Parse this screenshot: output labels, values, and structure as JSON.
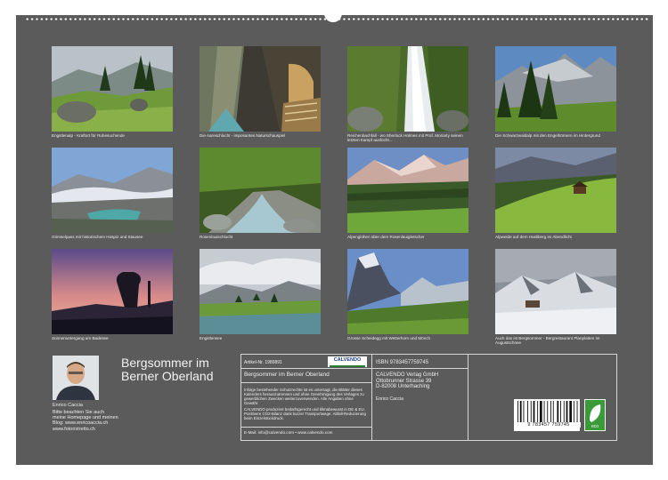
{
  "photos": [
    {
      "caption": "Engstlenalp - Kraftort für Ruhesuchende"
    },
    {
      "caption": "Die Aareschlucht - imposantes Naturschauspiel"
    },
    {
      "caption": "Reichenbachfall - wo Sherlock Holmes mit Prof. Moriarty seinen letzten Kampf ausfocht..."
    },
    {
      "caption": "Die Schwarzwaldalp mit den Engelhörnern im Hintergrund"
    },
    {
      "caption": "Grimselpass mit historischem Hospiz und Stausee"
    },
    {
      "caption": "Rosenlauischlucht"
    },
    {
      "caption": "Alpenglühen über dem Rosenlauigletscher"
    },
    {
      "caption": "Alpweide auf dem Hasliberg im Abendlicht"
    },
    {
      "caption": "Sonnenuntergang am Badesee"
    },
    {
      "caption": "Engstlensee"
    },
    {
      "caption": "Grosse Scheidegg mit Wetterhorn und Mönch"
    },
    {
      "caption": "Auch das ist Bergsommer - Bergrestaurant Planplatten im Augustschnee"
    }
  ],
  "title_line1": "Bergsommer im",
  "title_line2": "Berner Oberland",
  "author": {
    "name": "Enrico Caccia",
    "note_lines": [
      "Bitte beachten Sie auch",
      "meine Homepage und meinen",
      "Blog: www.enricoaccia.ch",
      "www.fotoristretto.ch"
    ]
  },
  "info": {
    "article_no": "Artikel-Nr. 1989891",
    "logo": "CALVENDO",
    "product_title": "Bergsommer im Berner Oberland",
    "legal1": "Infolge bestehender Schutzrechte ist es untersagt, die Blätter dieses Kalenders herauszutrennen und ohne Genehmigung des Verlages zu gewerblichen Zwecken weiterzuverwenden. Alle Angaben ohne Gewähr.",
    "legal2": "CALVENDO produziert bedarfsgerecht und klimabewusst in DE & EU. Positivere CO2-Bilanz dank kurzer Transportwege. Abfall-Reduzierung beim Einzelstückdruck.",
    "contact": "E-Mail: info@calvendo.com • www.calvendo.com",
    "isbn": "ISBN 9783457759745",
    "publisher_lines": [
      "CALVENDO Verlag GmbH",
      "Ottobrunner Strasse 39",
      "D-82008 Unterhaching"
    ],
    "author_credit": "Enrico Caccia",
    "barcode_number": "9 783457 759745",
    "eco_label": "eco"
  },
  "colors": {
    "background": "#5b5b5b",
    "text": "#f2f2f2",
    "border": "#d6d6d6"
  }
}
